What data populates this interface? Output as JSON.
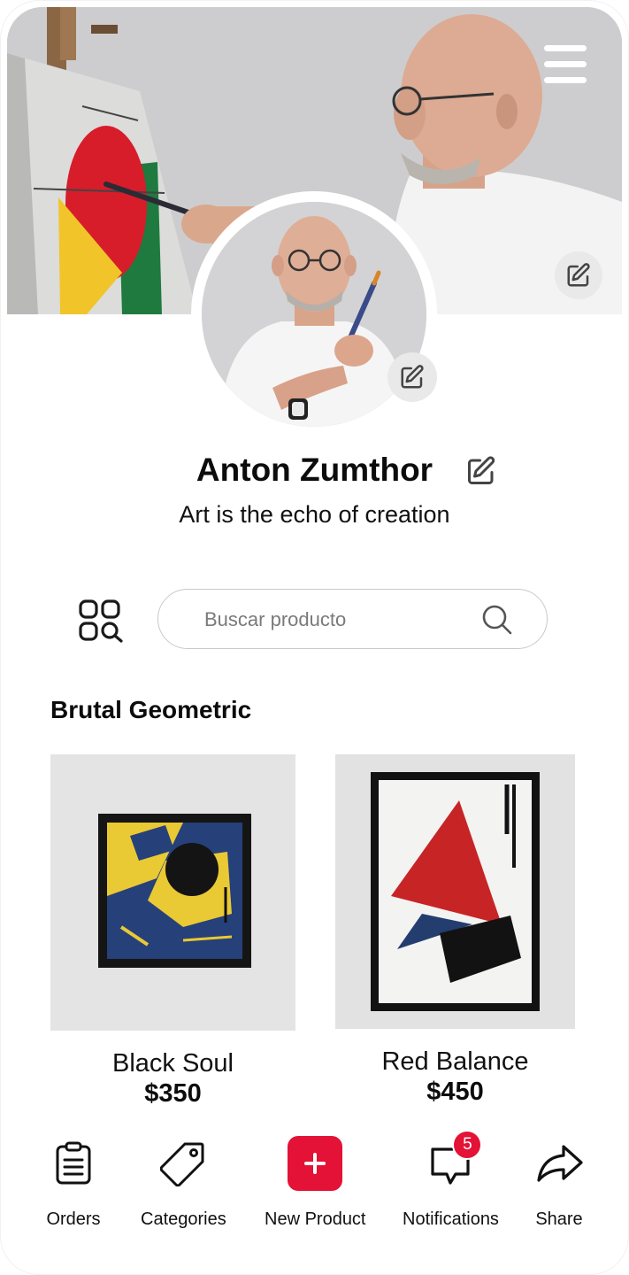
{
  "profile": {
    "name": "Anton Zumthor",
    "tagline": "Art is the echo of creation"
  },
  "search": {
    "placeholder": "Buscar producto"
  },
  "section": {
    "title": "Brutal Geometric"
  },
  "products": [
    {
      "name": "Black Soul",
      "price": "$350"
    },
    {
      "name": "Red Balance",
      "price": "$450"
    }
  ],
  "nav": {
    "orders": "Orders",
    "categories": "Categories",
    "new_product": "New Product",
    "notifications": "Notifications",
    "notifications_count": "5",
    "share": "Share"
  },
  "colors": {
    "accent": "#e31236",
    "text": "#0c0c0c",
    "search_border": "#c9c9c9",
    "edit_button_bg": "#e9e9ea"
  },
  "icons": [
    "menu-icon",
    "edit-icon",
    "grid-search-icon",
    "search-icon",
    "orders-icon",
    "tag-icon",
    "plus-icon",
    "chat-icon",
    "share-icon"
  ]
}
